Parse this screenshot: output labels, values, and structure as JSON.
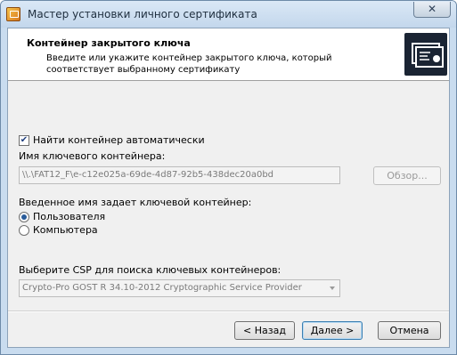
{
  "window": {
    "title": "Мастер установки личного сертификата",
    "close_glyph": "✕"
  },
  "header": {
    "title": "Контейнер закрытого ключа",
    "description": "Введите или укажите контейнер закрытого ключа, который соответствует выбранному сертификату"
  },
  "auto_find": {
    "label": "Найти контейнер автоматически",
    "checked": true,
    "check_glyph": "✔"
  },
  "container": {
    "label": "Имя ключевого контейнера:",
    "value": "\\\\.\\FAT12_F\\e-c12e025a-69de-4d87-92b5-438dec20a0bd",
    "browse_label": "Обзор..."
  },
  "key_owner": {
    "label": "Введенное имя задает ключевой контейнер:",
    "options": [
      {
        "label": "Пользователя",
        "selected": true
      },
      {
        "label": "Компьютера",
        "selected": false
      }
    ]
  },
  "csp": {
    "label": "Выберите CSP для поиска ключевых контейнеров:",
    "selected": "Crypto-Pro GOST R 34.10-2012 Cryptographic Service Provider"
  },
  "footer": {
    "back_label": "< Назад",
    "next_label": "Далее >",
    "cancel_label": "Отмена"
  }
}
